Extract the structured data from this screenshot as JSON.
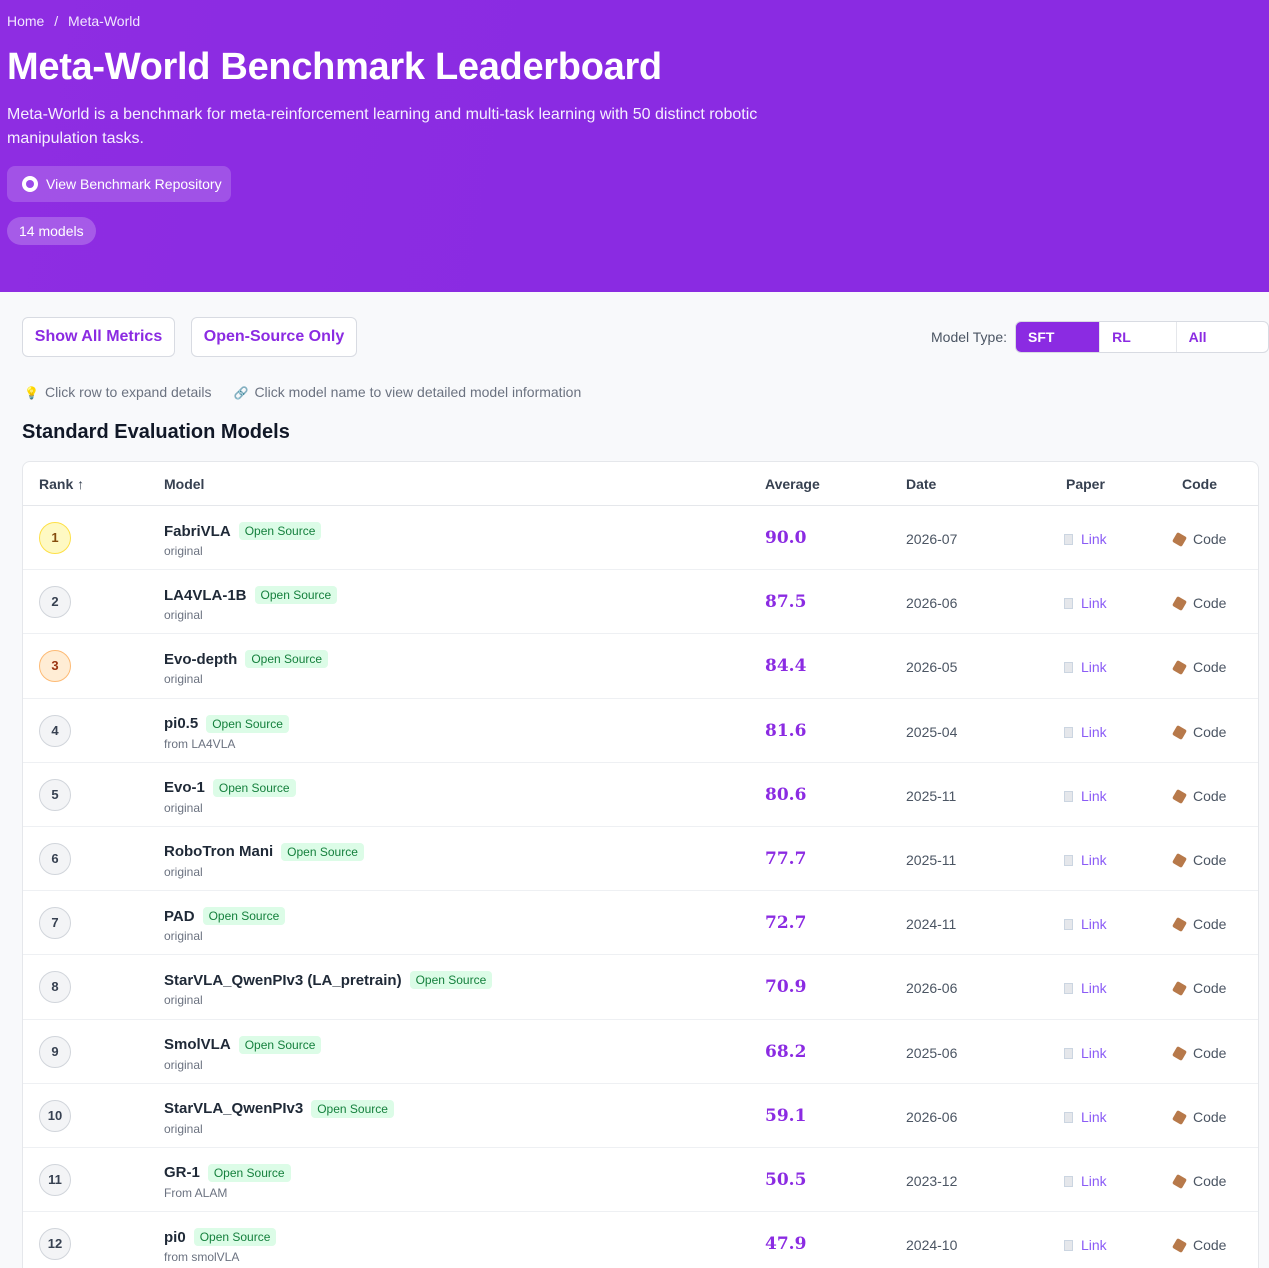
{
  "breadcrumb": {
    "home": "Home",
    "sep": "/",
    "current": "Meta-World"
  },
  "header": {
    "title": "Meta-World Benchmark Leaderboard",
    "description": "Meta-World is a benchmark for meta-reinforcement learning and multi-task learning with 50 distinct robotic manipulation tasks.",
    "repo_button": "View Benchmark Repository",
    "model_count": "14 models"
  },
  "controls": {
    "show_all_metrics": "Show All Metrics",
    "open_source_only": "Open-Source Only",
    "model_type_label": "Model Type:",
    "model_types": [
      "SFT Only",
      "RL Only",
      "All Models"
    ],
    "active_type": "SFT Only"
  },
  "hints": {
    "expand": "Click row to expand details",
    "model_info": "Click model name to view detailed model information"
  },
  "section_title": "Standard Evaluation Models",
  "table": {
    "headers": {
      "rank": "Rank ↑",
      "model": "Model",
      "average": "Average",
      "date": "Date",
      "paper": "Paper",
      "code": "Code"
    },
    "rows": [
      {
        "rank": "1",
        "name": "FabriVLA",
        "badge": "Open Source",
        "sub": "original",
        "avg": "90.0",
        "date": "2026-07",
        "paper": "Link",
        "code": "Code"
      },
      {
        "rank": "2",
        "name": "LA4VLA-1B",
        "badge": "Open Source",
        "sub": "original",
        "avg": "87.5",
        "date": "2026-06",
        "paper": "Link",
        "code": "Code"
      },
      {
        "rank": "3",
        "name": "Evo-depth",
        "badge": "Open Source",
        "sub": "original",
        "avg": "84.4",
        "date": "2026-05",
        "paper": "Link",
        "code": "Code"
      },
      {
        "rank": "4",
        "name": "pi0.5",
        "badge": "Open Source",
        "sub": "from LA4VLA",
        "avg": "81.6",
        "date": "2025-04",
        "paper": "Link",
        "code": "Code"
      },
      {
        "rank": "5",
        "name": "Evo-1",
        "badge": "Open Source",
        "sub": "original",
        "avg": "80.6",
        "date": "2025-11",
        "paper": "Link",
        "code": "Code"
      },
      {
        "rank": "6",
        "name": "RoboTron Mani",
        "badge": "Open Source",
        "sub": "original",
        "avg": "77.7",
        "date": "2025-11",
        "paper": "Link",
        "code": "Code"
      },
      {
        "rank": "7",
        "name": "PAD",
        "badge": "Open Source",
        "sub": "original",
        "avg": "72.7",
        "date": "2024-11",
        "paper": "Link",
        "code": "Code"
      },
      {
        "rank": "8",
        "name": "StarVLA_QwenPIv3 (LA_pretrain)",
        "badge": "Open Source",
        "sub": "original",
        "avg": "70.9",
        "date": "2026-06",
        "paper": "Link",
        "code": "Code"
      },
      {
        "rank": "9",
        "name": "SmolVLA",
        "badge": "Open Source",
        "sub": "original",
        "avg": "68.2",
        "date": "2025-06",
        "paper": "Link",
        "code": "Code"
      },
      {
        "rank": "10",
        "name": "StarVLA_QwenPIv3",
        "badge": "Open Source",
        "sub": "original",
        "avg": "59.1",
        "date": "2026-06",
        "paper": "Link",
        "code": "Code"
      },
      {
        "rank": "11",
        "name": "GR-1",
        "badge": "Open Source",
        "sub": "From ALAM",
        "avg": "50.5",
        "date": "2023-12",
        "paper": "Link",
        "code": "Code"
      },
      {
        "rank": "12",
        "name": "pi0",
        "badge": "Open Source",
        "sub": "from smolVLA",
        "avg": "47.9",
        "date": "2024-10",
        "paper": "Link",
        "code": "Code"
      }
    ]
  },
  "colors": {
    "accent": "#8b2be2",
    "badge_bg": "#dcfce7",
    "badge_text": "#15803d"
  }
}
